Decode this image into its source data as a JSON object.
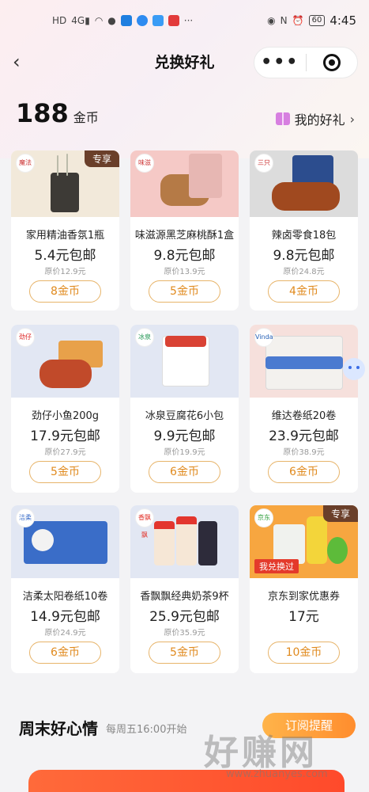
{
  "status": {
    "left_items": [
      "HD",
      "4G",
      "signal",
      "wifi",
      "location"
    ],
    "battery": "60",
    "time": "4:45"
  },
  "nav": {
    "title": "兑换好礼",
    "more_label": "•••"
  },
  "coins": {
    "amount": "188",
    "unit": "金币"
  },
  "my_gifts": {
    "label": "我的好礼"
  },
  "products": [
    {
      "name": "家用精油香氛1瓶",
      "price": "5.4元包邮",
      "orig": "原价12.9元",
      "coin": "8金币",
      "exclusive": "专享",
      "img_bg": "#f2e9da",
      "badge": "魔法"
    },
    {
      "name": "味滋源黑芝麻桃酥1盒",
      "price": "9.8元包邮",
      "orig": "原价13.9元",
      "coin": "5金币",
      "img_bg": "#f5c9c6",
      "badge": "味滋"
    },
    {
      "name": "辣卤零食18包",
      "price": "9.8元包邮",
      "orig": "原价24.8元",
      "coin": "4金币",
      "img_bg": "#dcdcdc",
      "badge": "三只"
    },
    {
      "name": "劲仔小鱼200g",
      "price": "17.9元包邮",
      "orig": "原价27.9元",
      "coin": "5金币",
      "img_bg": "#e2e7f3",
      "badge": "劲仔"
    },
    {
      "name": "冰泉豆腐花6小包",
      "price": "9.9元包邮",
      "orig": "原价19.9元",
      "coin": "6金币",
      "img_bg": "#e2e7f3",
      "badge": "冰泉"
    },
    {
      "name": "维达卷纸20卷",
      "price": "23.9元包邮",
      "orig": "原价38.9元",
      "coin": "6金币",
      "img_bg": "#f6e0dc",
      "badge": "Vinda"
    },
    {
      "name": "洁柔太阳卷纸10卷",
      "price": "14.9元包邮",
      "orig": "原价24.9元",
      "coin": "6金币",
      "img_bg": "#e2e7f3",
      "badge": "洁柔"
    },
    {
      "name": "香飘飘经典奶茶9杯",
      "price": "25.9元包邮",
      "orig": "原价35.9元",
      "coin": "5金币",
      "img_bg": "#e2e7f3",
      "badge": "香飘飘"
    },
    {
      "name": "京东到家优惠券",
      "price": "17元",
      "orig": "",
      "coin": "10金币",
      "exclusive": "专享",
      "redeemed": "我兑换过",
      "img_bg": "#f7a640",
      "badge": "京东"
    }
  ],
  "weekend": {
    "title": "周末好心情",
    "subtitle": "每周五16:00开始",
    "remind": "订阅提醒"
  },
  "watermark": {
    "text": "好赚网",
    "url": "www.zhuanyes.com"
  }
}
